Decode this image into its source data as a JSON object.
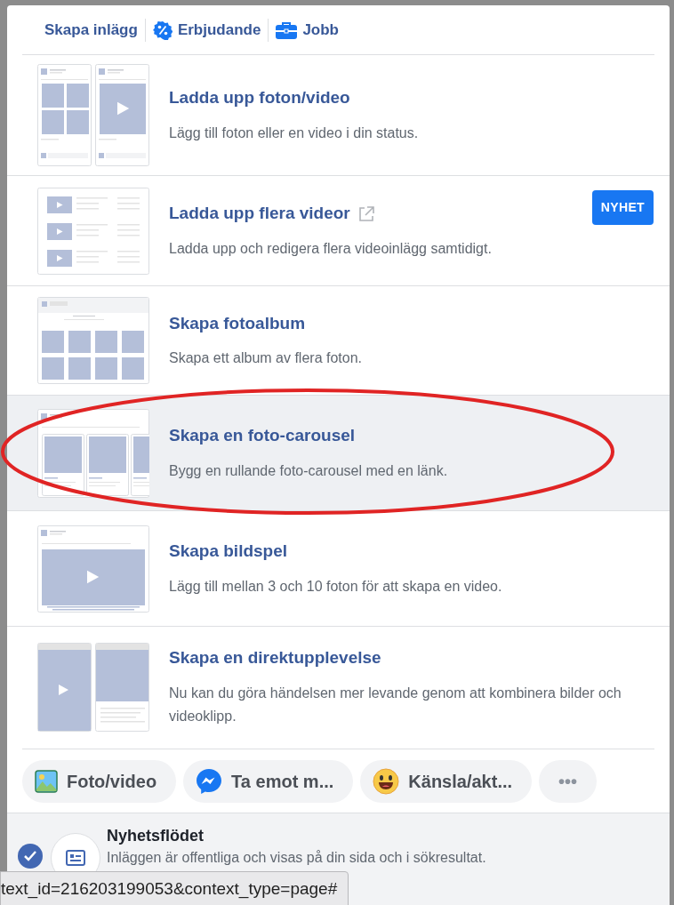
{
  "tabs": [
    {
      "label": "Skapa inlägg",
      "kind": "text"
    },
    {
      "label": "Erbjudande",
      "kind": "offer"
    },
    {
      "label": "Jobb",
      "kind": "job"
    }
  ],
  "options": [
    {
      "title": "Ladda upp foton/video",
      "description": "Lägg till foton eller en video i din status.",
      "kind": "photos",
      "selected": false,
      "external_link": false
    },
    {
      "title": "Ladda upp flera videor",
      "description": "Ladda upp och redigera flera videoinlägg samtidigt.",
      "kind": "videos",
      "selected": false,
      "external_link": true,
      "badge": "NYHET"
    },
    {
      "title": "Skapa fotoalbum",
      "description": "Skapa ett album av flera foton.",
      "kind": "album",
      "selected": false,
      "external_link": false
    },
    {
      "title": "Skapa en foto-carousel",
      "description": "Bygg en rullande foto-carousel med en länk.",
      "kind": "carousel",
      "selected": true,
      "external_link": false
    },
    {
      "title": "Skapa bildspel",
      "description": "Lägg till mellan 3 och 10 foton för att skapa en video.",
      "kind": "slideshow",
      "selected": false,
      "external_link": false
    },
    {
      "title": "Skapa en direktupplevelse",
      "description": "Nu kan du göra händelsen mer levande genom att kombinera bilder och videoklipp.",
      "kind": "instant",
      "selected": false,
      "external_link": false
    }
  ],
  "actions": [
    {
      "label": "Foto/video",
      "kind": "photo"
    },
    {
      "label": "Ta emot m...",
      "kind": "message"
    },
    {
      "label": "Känsla/akt...",
      "kind": "feeling"
    },
    {
      "label": "•••",
      "kind": "more"
    }
  ],
  "audience": {
    "title": "Nyhetsflödet",
    "description": "Inläggen är offentliga och visas på din sida och i sökresultat.",
    "checked": true
  },
  "status_url": "text_id=216203199053&context_type=page#"
}
